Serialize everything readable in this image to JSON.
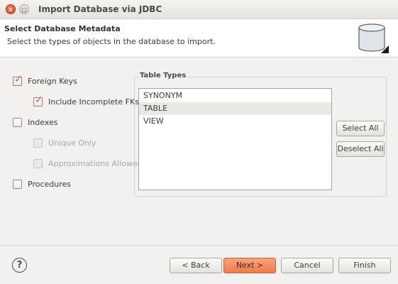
{
  "window": {
    "title": "Import Database via JDBC",
    "close_icon": "×",
    "maximize_icon": "□"
  },
  "header": {
    "title": "Select Database Metadata",
    "description": "Select the types of objects in the database to import.",
    "icon": "database-icon"
  },
  "options": {
    "foreign_keys": {
      "label": "Foreign Keys",
      "checked": true
    },
    "include_incomplete_fks": {
      "label": "Include Incomplete FKs",
      "checked": true
    },
    "indexes": {
      "label": "Indexes",
      "checked": false
    },
    "unique_only": {
      "label": "Unique Only",
      "checked": false,
      "disabled": true
    },
    "approximations_allowed": {
      "label": "Approximations Allowed",
      "checked": false,
      "disabled": true
    },
    "procedures": {
      "label": "Procedures",
      "checked": false
    }
  },
  "table_types": {
    "legend": "Table Types",
    "items": [
      "SYNONYM",
      "TABLE",
      "VIEW"
    ],
    "selected": "TABLE",
    "select_all_label": "Select All",
    "deselect_all_label": "Deselect All"
  },
  "footer": {
    "help_label": "?",
    "back_label": "< Back",
    "next_label": "Next >",
    "cancel_label": "Cancel",
    "finish_label": "Finish"
  },
  "colors": {
    "accent": "#ef7b4c",
    "check": "#e05a2b",
    "close_button": "#e25c33"
  }
}
